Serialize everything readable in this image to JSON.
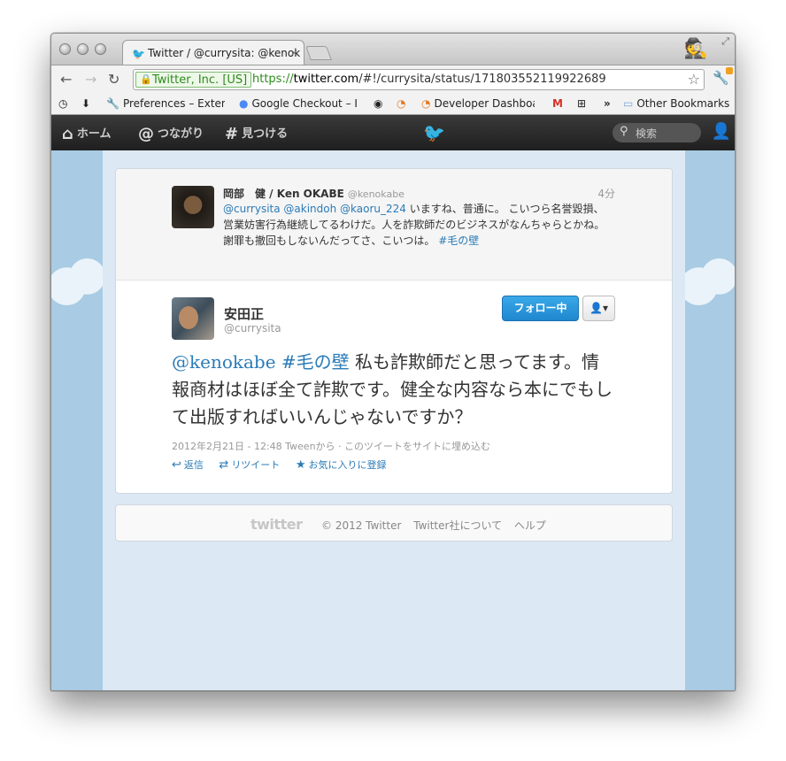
{
  "browser": {
    "tab_title": "Twitter / @currysita: @kenok",
    "tab_close": "×",
    "ev_label": "Twitter, Inc. [US]",
    "url_scheme": "https://",
    "url_host": "twitter.com",
    "url_path": "/#!/currysita/status/171803552119922689",
    "bookmarks": [
      {
        "label": "Preferences – Extens",
        "icon": "wrench-icon"
      },
      {
        "label": "Google Checkout – I",
        "icon": "google-icon"
      },
      {
        "label": "Developer Dashboar",
        "icon": "rss-icon"
      },
      {
        "label": "Other Bookmarks",
        "icon": "folder-icon"
      }
    ],
    "chevron": "»"
  },
  "twitter_nav": {
    "home": "ホーム",
    "connect": "つながり",
    "discover": "見つける",
    "search_placeholder": "検索"
  },
  "reply_tweet": {
    "name": "岡部　健 / Ken OKABE",
    "handle": "@kenokabe",
    "time": "4分",
    "mentions": "@currysita @akindoh @kaoru_224",
    "text": " いますね、普通に。 こいつら名誉毀損、営業妨害行為継続してるわけだ。人を詐欺師だのビジネスがなんちゃらとかね。謝罪も撤回もしないんだってさ、こいつは。 ",
    "hashtag": "#毛の壁"
  },
  "main_tweet": {
    "name": "安田正",
    "handle": "@currysita",
    "follow_label": "フォロー中",
    "user_menu_label": "▾",
    "mention": "@kenokabe",
    "hashtag": "#毛の壁",
    "text": " 私も詐欺師だと思ってます。情報商材はほぼ全て詐欺です。健全な内容なら本にでもして出版すればいいんじゃないですか？",
    "meta": "2012年2月21日 - 12:48 Tweenから · このツイートをサイトに埋め込む",
    "actions": {
      "reply": "返信",
      "retweet": "リツイート",
      "favorite": "お気に入りに登録"
    }
  },
  "footer": {
    "logo": "twitter",
    "copyright": "© 2012 Twitter",
    "about": "Twitter社について",
    "help": "ヘルプ"
  },
  "colors": {
    "link": "#2a7bb7",
    "follow_button": "#1f87cf",
    "topbar": "#2b2b2b",
    "ev_green": "#2e8b1e"
  }
}
